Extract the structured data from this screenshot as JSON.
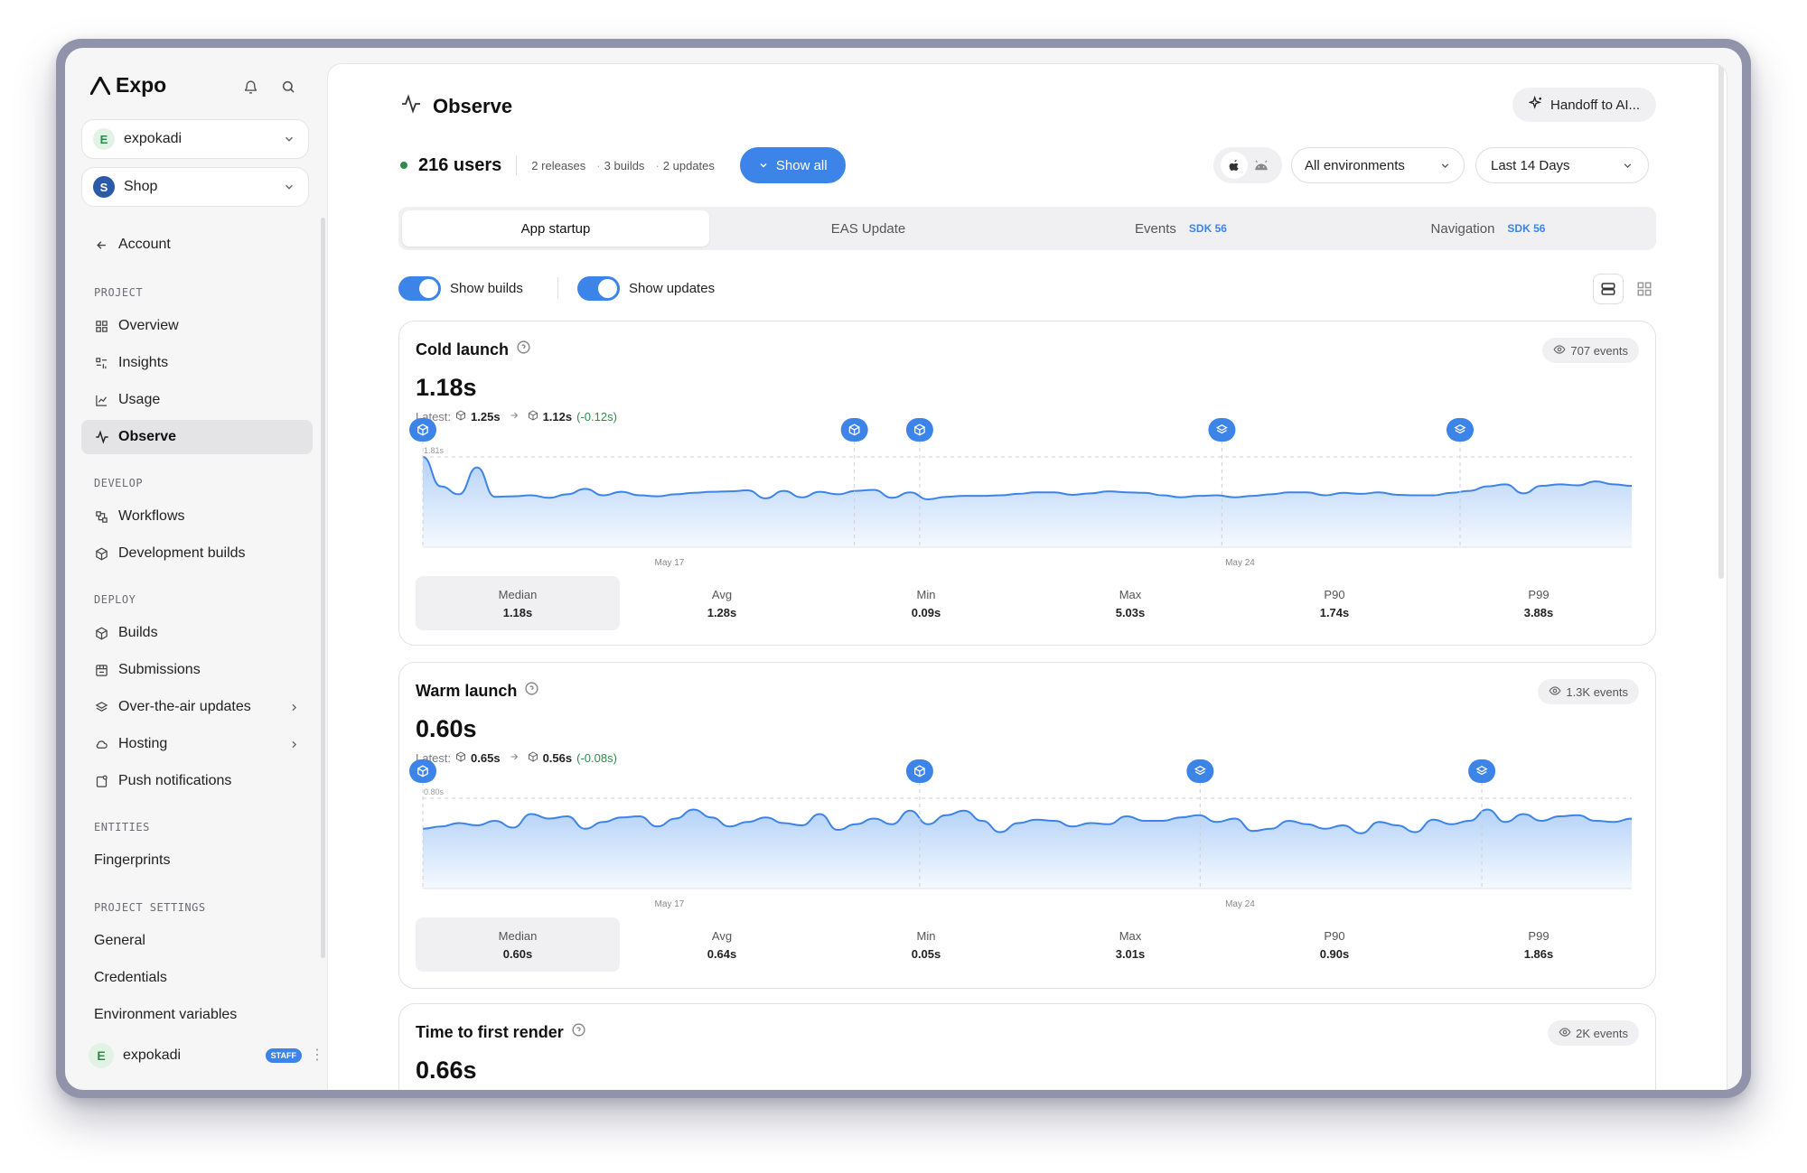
{
  "app": {
    "name": "Expo"
  },
  "sidebar": {
    "account_selector": {
      "initial": "E",
      "label": "expokadi"
    },
    "project_selector": {
      "initial": "S",
      "label": "Shop"
    },
    "back": {
      "label": "Account"
    },
    "sections": {
      "project": "PROJECT",
      "develop": "DEVELOP",
      "deploy": "DEPLOY",
      "entities": "ENTITIES",
      "settings": "PROJECT SETTINGS"
    },
    "project_items": [
      {
        "label": "Overview",
        "icon": "grid-icon"
      },
      {
        "label": "Insights",
        "icon": "insights-icon"
      },
      {
        "label": "Usage",
        "icon": "chart-line-icon"
      },
      {
        "label": "Observe",
        "icon": "pulse-icon",
        "active": true
      }
    ],
    "develop_items": [
      {
        "label": "Workflows",
        "icon": "workflow-icon"
      },
      {
        "label": "Development builds",
        "icon": "cube-icon"
      }
    ],
    "deploy_items": [
      {
        "label": "Builds",
        "icon": "cube-icon"
      },
      {
        "label": "Submissions",
        "icon": "submissions-icon"
      },
      {
        "label": "Over-the-air updates",
        "icon": "layers-icon",
        "expandable": true
      },
      {
        "label": "Hosting",
        "icon": "cloud-icon",
        "expandable": true
      },
      {
        "label": "Push notifications",
        "icon": "push-icon"
      }
    ],
    "entities_items": [
      {
        "label": "Fingerprints"
      }
    ],
    "settings_items": [
      {
        "label": "General"
      },
      {
        "label": "Credentials"
      },
      {
        "label": "Environment variables"
      }
    ],
    "user": {
      "initial": "E",
      "name": "expokadi",
      "badge": "STAFF"
    }
  },
  "header": {
    "title": "Observe",
    "handoff_button": "Handoff to AI...",
    "users": "216 users",
    "releases": "2 releases",
    "builds": "3 builds",
    "updates": "2 updates",
    "show_all": "Show all",
    "environment": "All environments",
    "range": "Last 14 Days"
  },
  "tabs": [
    {
      "label": "App startup",
      "active": true,
      "badge": ""
    },
    {
      "label": "EAS Update",
      "badge": ""
    },
    {
      "label": "Events",
      "badge": "SDK 56"
    },
    {
      "label": "Navigation",
      "badge": "SDK 56"
    }
  ],
  "toggles": {
    "builds": "Show builds",
    "updates": "Show updates"
  },
  "cards": [
    {
      "title": "Cold launch",
      "value": "1.18s",
      "latest_label": "Latest:",
      "latest_from": "1.25s",
      "latest_to": "1.12s",
      "latest_delta": "(-0.12s)",
      "events": "707 events",
      "stats": [
        {
          "label": "Median",
          "value": "1.18s"
        },
        {
          "label": "Avg",
          "value": "1.28s"
        },
        {
          "label": "Min",
          "value": "0.09s"
        },
        {
          "label": "Max",
          "value": "5.03s"
        },
        {
          "label": "P90",
          "value": "1.74s"
        },
        {
          "label": "P99",
          "value": "3.88s"
        }
      ]
    },
    {
      "title": "Warm launch",
      "value": "0.60s",
      "latest_label": "Latest:",
      "latest_from": "0.65s",
      "latest_to": "0.56s",
      "latest_delta": "(-0.08s)",
      "events": "1.3K events",
      "stats": [
        {
          "label": "Median",
          "value": "0.60s"
        },
        {
          "label": "Avg",
          "value": "0.64s"
        },
        {
          "label": "Min",
          "value": "0.05s"
        },
        {
          "label": "Max",
          "value": "3.01s"
        },
        {
          "label": "P90",
          "value": "0.90s"
        },
        {
          "label": "P99",
          "value": "1.86s"
        }
      ]
    },
    {
      "title": "Time to first render",
      "value": "0.66s",
      "events": "2K events"
    }
  ],
  "chart_data": [
    {
      "type": "area",
      "series": [
        {
          "values": [
            1.81,
            1.22,
            1.06,
            1.6,
            1.01,
            1.02,
            1.04,
            0.99,
            1.06,
            1.17,
            1.04,
            1.11,
            1.04,
            1.02,
            1.06,
            1.09,
            1.11,
            1.12,
            1.14,
            0.98,
            1.13,
            1.0,
            1.11,
            1.06,
            1.13,
            1.15,
            0.99,
            1.1,
            0.96,
            1.01,
            1.03,
            1.03,
            1.04,
            1.07,
            1.1,
            1.1,
            1.05,
            1.08,
            1.12,
            1.1,
            1.09,
            1.04,
            1.0,
            1.03,
            1.04,
            1.0,
            1.03,
            1.06,
            1.1,
            1.1,
            1.04,
            1.09,
            1.07,
            1.1,
            1.05,
            1.04,
            1.04,
            1.09,
            1.13,
            1.22,
            1.26,
            1.08,
            1.23,
            1.26,
            1.24,
            1.32,
            1.26,
            1.23
          ]
        }
      ],
      "x_tick_labels": [
        "May 17",
        "May 24"
      ],
      "y_max_label": "1.81s",
      "markers": [
        {
          "x_fraction": 0.0,
          "kind": "build"
        },
        {
          "x_fraction": 0.357,
          "kind": "build"
        },
        {
          "x_fraction": 0.411,
          "kind": "build"
        },
        {
          "x_fraction": 0.661,
          "kind": "update"
        },
        {
          "x_fraction": 0.858,
          "kind": "update"
        }
      ]
    },
    {
      "type": "area",
      "series": [
        {
          "values": [
            0.53,
            0.55,
            0.58,
            0.56,
            0.6,
            0.54,
            0.66,
            0.62,
            0.64,
            0.53,
            0.59,
            0.63,
            0.64,
            0.55,
            0.62,
            0.7,
            0.63,
            0.55,
            0.59,
            0.63,
            0.58,
            0.56,
            0.66,
            0.52,
            0.57,
            0.62,
            0.57,
            0.69,
            0.57,
            0.65,
            0.69,
            0.6,
            0.5,
            0.58,
            0.61,
            0.6,
            0.55,
            0.58,
            0.57,
            0.64,
            0.6,
            0.6,
            0.63,
            0.65,
            0.59,
            0.62,
            0.51,
            0.53,
            0.6,
            0.57,
            0.53,
            0.56,
            0.49,
            0.59,
            0.56,
            0.5,
            0.61,
            0.57,
            0.6,
            0.7,
            0.59,
            0.66,
            0.6,
            0.64,
            0.65,
            0.6,
            0.59,
            0.62
          ]
        }
      ],
      "x_tick_labels": [
        "May 17",
        "May 24"
      ],
      "y_max_label": "0.80s",
      "markers": [
        {
          "x_fraction": 0.0,
          "kind": "build"
        },
        {
          "x_fraction": 0.411,
          "kind": "build"
        },
        {
          "x_fraction": 0.643,
          "kind": "update"
        },
        {
          "x_fraction": 0.876,
          "kind": "update"
        }
      ]
    }
  ]
}
